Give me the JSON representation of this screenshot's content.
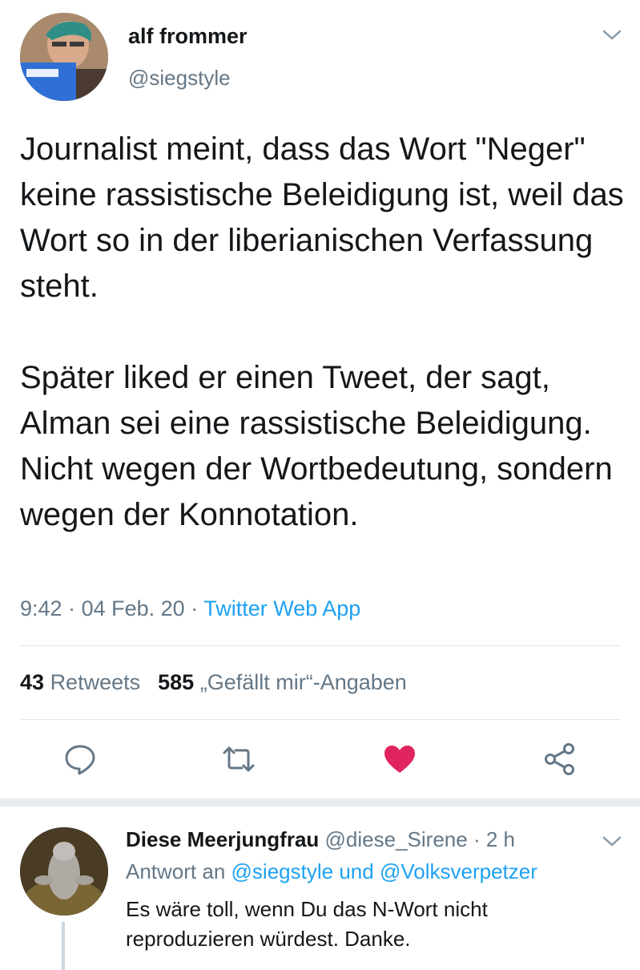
{
  "tweet": {
    "author_name": "alf frommer",
    "author_handle": "@siegstyle",
    "paragraphs": [
      "Journalist meint, dass das Wort \"Neger\" keine rassistische Beleidigung ist, weil das Wort so in der liberianischen Verfassung steht.",
      "Später liked er einen Tweet, der sagt, Alman sei eine rassistische Beleidigung. Nicht wegen der Wortbedeutung, sondern wegen der Konnotation."
    ],
    "time": "9:42",
    "date": "04 Feb. 20",
    "source": "Twitter Web App",
    "retweet_count": "43",
    "retweet_label": "Retweets",
    "like_count": "585",
    "like_label": "„Gefällt mir“-Angaben",
    "actions": [
      "reply-icon",
      "retweet-icon",
      "like-icon",
      "share-icon"
    ],
    "like_color": "#e0245e"
  },
  "reply": {
    "author_name": "Diese Meerjungfrau",
    "author_handle": "@diese_Sirene",
    "time": "2 h",
    "reply_to_prefix": "Antwort an",
    "mention_1": "@siegstyle",
    "conjunction": "und",
    "mention_2": "@Volksverpetzer",
    "text_line_1": "Es wäre toll, wenn Du das N-Wort nicht",
    "text_line_2": "reproduzieren würdest. Danke."
  },
  "colors": {
    "link": "#1da1f2",
    "secondary_text": "#657786",
    "primary_text": "#14171a"
  }
}
